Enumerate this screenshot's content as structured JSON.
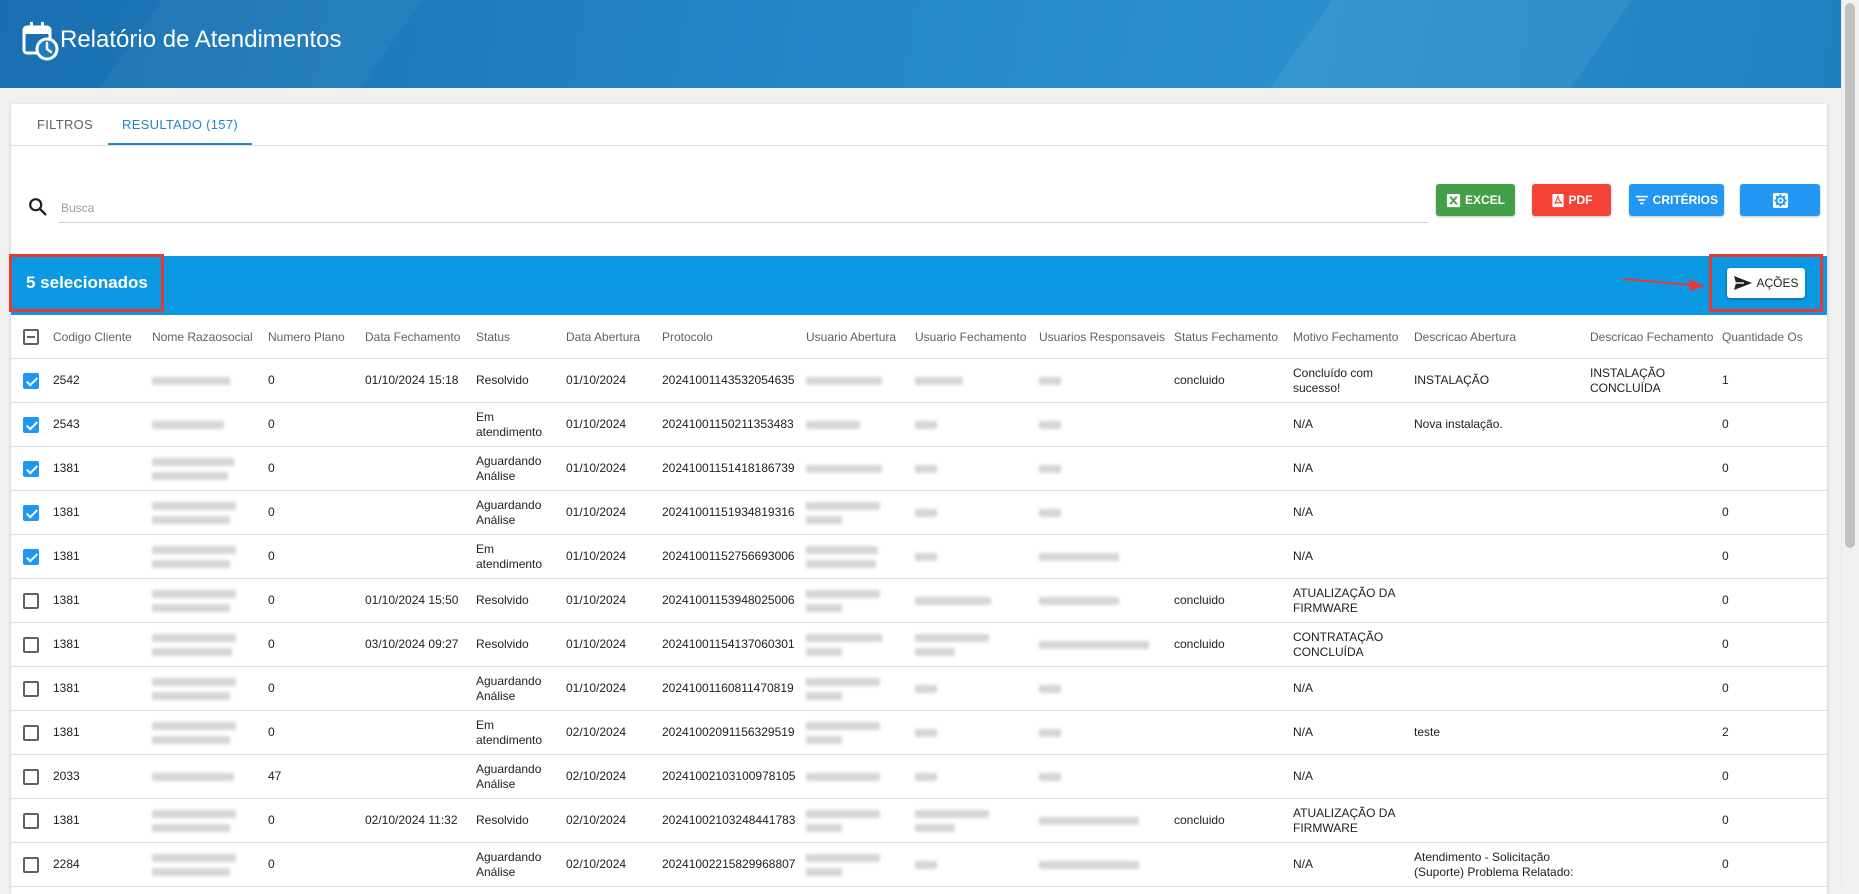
{
  "app": {
    "title": "Relatório de Atendimentos",
    "icon": "calendar-clock-icon"
  },
  "tabs": [
    {
      "label": "FILTROS",
      "active": false
    },
    {
      "label": "RESULTADO (157)",
      "active": true
    }
  ],
  "search": {
    "placeholder": "Busca",
    "value": ""
  },
  "toolbar": {
    "excel_label": "EXCEL",
    "pdf_label": "PDF",
    "criteria_label": "CRITÉRIOS",
    "settings_icon": "gear-icon"
  },
  "selection": {
    "label": "5 selecionados",
    "actions_label": "AÇÕES"
  },
  "colors": {
    "header": "#1f80bf",
    "selection_bar": "#0b99e3",
    "excel": "#43a047",
    "pdf": "#f44336",
    "primary": "#2196f3",
    "highlight": "#e53935"
  },
  "table": {
    "columns": [
      "Codigo Cliente",
      "Nome Razaosocial",
      "Numero Plano",
      "Data Fechamento",
      "Status",
      "Data Abertura",
      "Protocolo",
      "Usuario Abertura",
      "Usuario Fechamento",
      "Usuarios Responsaveis",
      "Status Fechamento",
      "Motivo Fechamento",
      "Descricao Abertura",
      "Descricao Fechamento",
      "Quantidade Os"
    ],
    "rows": [
      {
        "checked": true,
        "codigo": "2542",
        "plano": "0",
        "data_fechamento": "01/10/2024 15:18",
        "status": "Resolvido",
        "data_abertura": "01/10/2024",
        "protocolo": "20241001143532054635",
        "status_fechamento": "concluido",
        "motivo": "Concluído com sucesso!",
        "desc_abertura": "INSTALAÇÃO",
        "desc_fechamento": "INSTALAÇÃO CONCLUÍDA",
        "qtd_os": "1"
      },
      {
        "checked": true,
        "codigo": "2543",
        "plano": "0",
        "data_fechamento": "",
        "status": "Em atendimento",
        "data_abertura": "01/10/2024",
        "protocolo": "20241001150211353483",
        "status_fechamento": "",
        "motivo": "N/A",
        "desc_abertura": "Nova instalação.",
        "desc_fechamento": "",
        "qtd_os": "0"
      },
      {
        "checked": true,
        "codigo": "1381",
        "plano": "0",
        "data_fechamento": "",
        "status": "Aguardando Análise",
        "data_abertura": "01/10/2024",
        "protocolo": "20241001151418186739",
        "status_fechamento": "",
        "motivo": "N/A",
        "desc_abertura": "",
        "desc_fechamento": "",
        "qtd_os": "0"
      },
      {
        "checked": true,
        "codigo": "1381",
        "plano": "0",
        "data_fechamento": "",
        "status": "Aguardando Análise",
        "data_abertura": "01/10/2024",
        "protocolo": "20241001151934819316",
        "status_fechamento": "",
        "motivo": "N/A",
        "desc_abertura": "",
        "desc_fechamento": "",
        "qtd_os": "0"
      },
      {
        "checked": true,
        "codigo": "1381",
        "plano": "0",
        "data_fechamento": "",
        "status": "Em atendimento",
        "data_abertura": "01/10/2024",
        "protocolo": "20241001152756693006",
        "status_fechamento": "",
        "motivo": "N/A",
        "desc_abertura": "",
        "desc_fechamento": "",
        "qtd_os": "0"
      },
      {
        "checked": false,
        "codigo": "1381",
        "plano": "0",
        "data_fechamento": "01/10/2024 15:50",
        "status": "Resolvido",
        "data_abertura": "01/10/2024",
        "protocolo": "20241001153948025006",
        "status_fechamento": "concluido",
        "motivo": "ATUALIZAÇÃO DA FIRMWARE",
        "desc_abertura": "",
        "desc_fechamento": "",
        "qtd_os": "0"
      },
      {
        "checked": false,
        "codigo": "1381",
        "plano": "0",
        "data_fechamento": "03/10/2024 09:27",
        "status": "Resolvido",
        "data_abertura": "01/10/2024",
        "protocolo": "20241001154137060301",
        "status_fechamento": "concluido",
        "motivo": "CONTRATAÇÃO CONCLUÍDA",
        "desc_abertura": "",
        "desc_fechamento": "",
        "qtd_os": "0"
      },
      {
        "checked": false,
        "codigo": "1381",
        "plano": "0",
        "data_fechamento": "",
        "status": "Aguardando Análise",
        "data_abertura": "01/10/2024",
        "protocolo": "20241001160811470819",
        "status_fechamento": "",
        "motivo": "N/A",
        "desc_abertura": "",
        "desc_fechamento": "",
        "qtd_os": "0"
      },
      {
        "checked": false,
        "codigo": "1381",
        "plano": "0",
        "data_fechamento": "",
        "status": "Em atendimento",
        "data_abertura": "02/10/2024",
        "protocolo": "20241002091156329519",
        "status_fechamento": "",
        "motivo": "N/A",
        "desc_abertura": "teste",
        "desc_fechamento": "",
        "qtd_os": "2"
      },
      {
        "checked": false,
        "codigo": "2033",
        "plano": "47",
        "data_fechamento": "",
        "status": "Aguardando Análise",
        "data_abertura": "02/10/2024",
        "protocolo": "20241002103100978105",
        "status_fechamento": "",
        "motivo": "N/A",
        "desc_abertura": "",
        "desc_fechamento": "",
        "qtd_os": "0"
      },
      {
        "checked": false,
        "codigo": "1381",
        "plano": "0",
        "data_fechamento": "02/10/2024 11:32",
        "status": "Resolvido",
        "data_abertura": "02/10/2024",
        "protocolo": "20241002103248441783",
        "status_fechamento": "concluido",
        "motivo": "ATUALIZAÇÃO DA FIRMWARE",
        "desc_abertura": "",
        "desc_fechamento": "",
        "qtd_os": "0"
      },
      {
        "checked": false,
        "codigo": "2284",
        "plano": "0",
        "data_fechamento": "",
        "status": "Aguardando Análise",
        "data_abertura": "02/10/2024",
        "protocolo": "20241002215829968807",
        "status_fechamento": "",
        "motivo": "N/A",
        "desc_abertura": "Atendimento - Solicitação (Suporte) Problema Relatado:",
        "desc_fechamento": "",
        "qtd_os": "0"
      }
    ]
  }
}
